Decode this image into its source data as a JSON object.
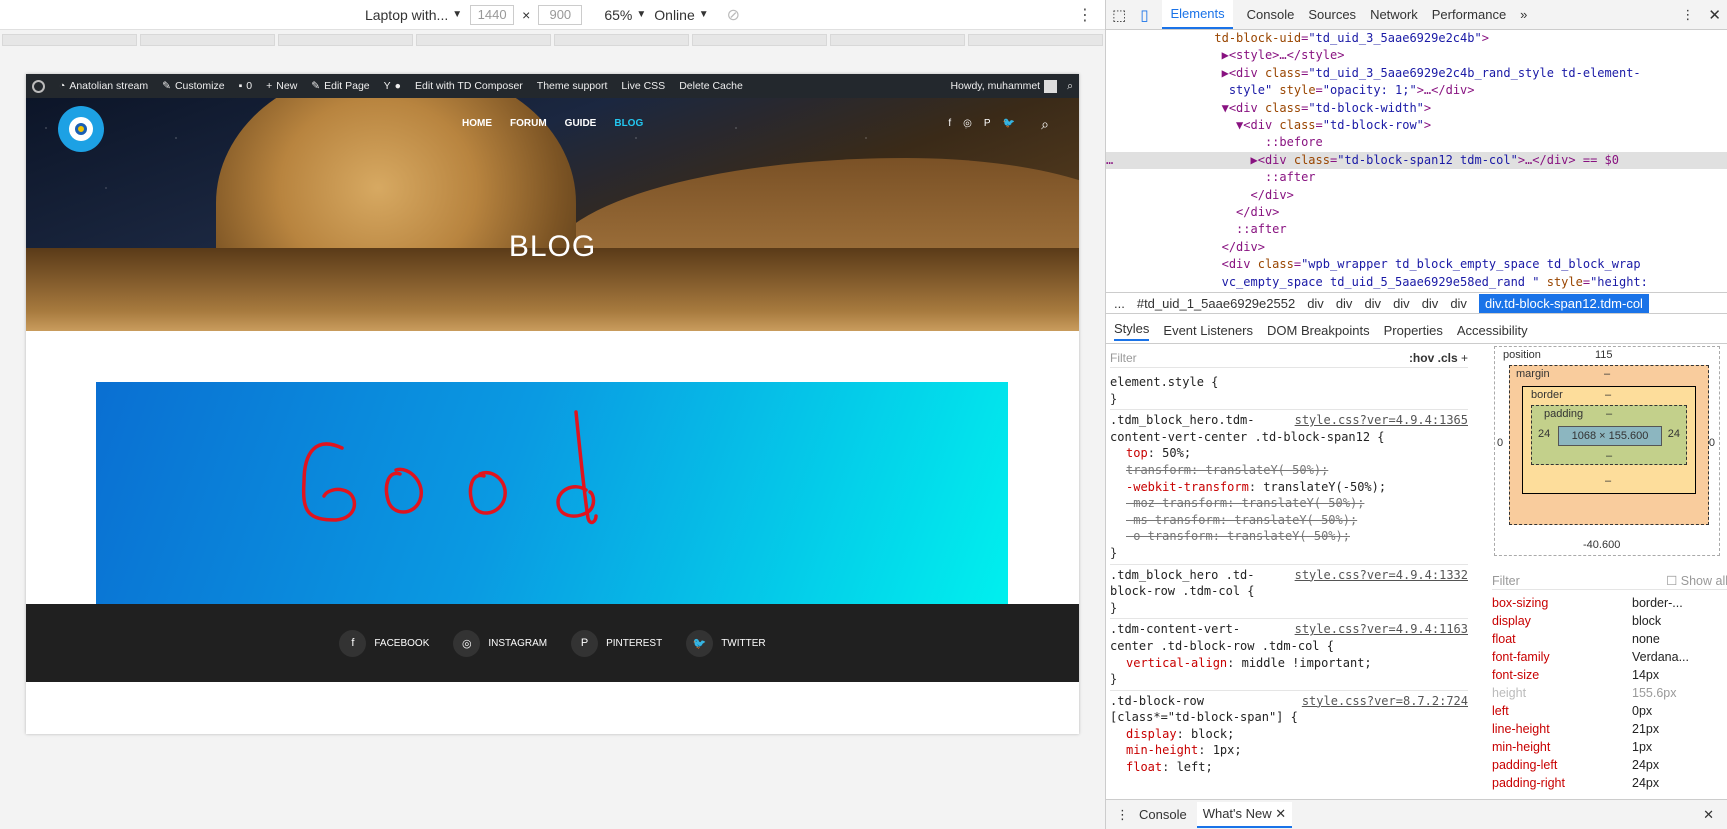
{
  "device_toolbar": {
    "device": "Laptop with...",
    "width": "1440",
    "height": "900",
    "times": "×",
    "zoom": "65%",
    "throttle": "Online"
  },
  "admin_bar": {
    "site": "Anatolian stream",
    "customize": "Customize",
    "comments": "0",
    "new": "New",
    "edit_page": "Edit Page",
    "edit_td": "Edit with TD Composer",
    "theme_support": "Theme support",
    "live_css": "Live CSS",
    "delete_cache": "Delete Cache",
    "howdy": "Howdy, muhammet"
  },
  "nav": [
    "HOME",
    "FORUM",
    "GUIDE",
    "BLOG"
  ],
  "nav_active": "BLOG",
  "hero_title": "BLOG",
  "handwriting": "Good",
  "footer_social": [
    {
      "icon": "f",
      "label": "FACEBOOK"
    },
    {
      "icon": "◎",
      "label": "INSTAGRAM"
    },
    {
      "icon": "P",
      "label": "PINTEREST"
    },
    {
      "icon": "🐦",
      "label": "TWITTER"
    }
  ],
  "devtools": {
    "tabs": [
      "Elements",
      "Console",
      "Sources",
      "Network",
      "Performance"
    ],
    "active_tab": "Elements",
    "breadcrumb": [
      "...",
      "#td_uid_1_5aae6929e2552",
      "div",
      "div",
      "div",
      "div",
      "div",
      "div",
      "div.td-block-span12.tdm-col"
    ],
    "style_tabs": [
      "Styles",
      "Event Listeners",
      "DOM Breakpoints",
      "Properties",
      "Accessibility"
    ],
    "filter_placeholder": "Filter",
    "hov": ":hov",
    "cls": ".cls",
    "show_all": "Show all",
    "drawer_tabs": [
      "Console",
      "What's New"
    ],
    "box_model": {
      "position_label": "position",
      "position_top": "115",
      "margin_label": "margin",
      "border_label": "border",
      "padding_label": "padding",
      "content": "1068 × 155.600",
      "padding_left": "24",
      "padding_right": "24",
      "margin_bottom": "-40.600",
      "left": "0",
      "right": "0",
      "dash": "–"
    },
    "computed": [
      {
        "name": "box-sizing",
        "value": "border-..."
      },
      {
        "name": "display",
        "value": "block"
      },
      {
        "name": "float",
        "value": "none"
      },
      {
        "name": "font-family",
        "value": "Verdana..."
      },
      {
        "name": "font-size",
        "value": "14px"
      },
      {
        "name": "height",
        "value": "155.6px",
        "dim": true
      },
      {
        "name": "left",
        "value": "0px"
      },
      {
        "name": "line-height",
        "value": "21px"
      },
      {
        "name": "min-height",
        "value": "1px"
      },
      {
        "name": "padding-left",
        "value": "24px"
      },
      {
        "name": "padding-right",
        "value": "24px"
      }
    ]
  }
}
